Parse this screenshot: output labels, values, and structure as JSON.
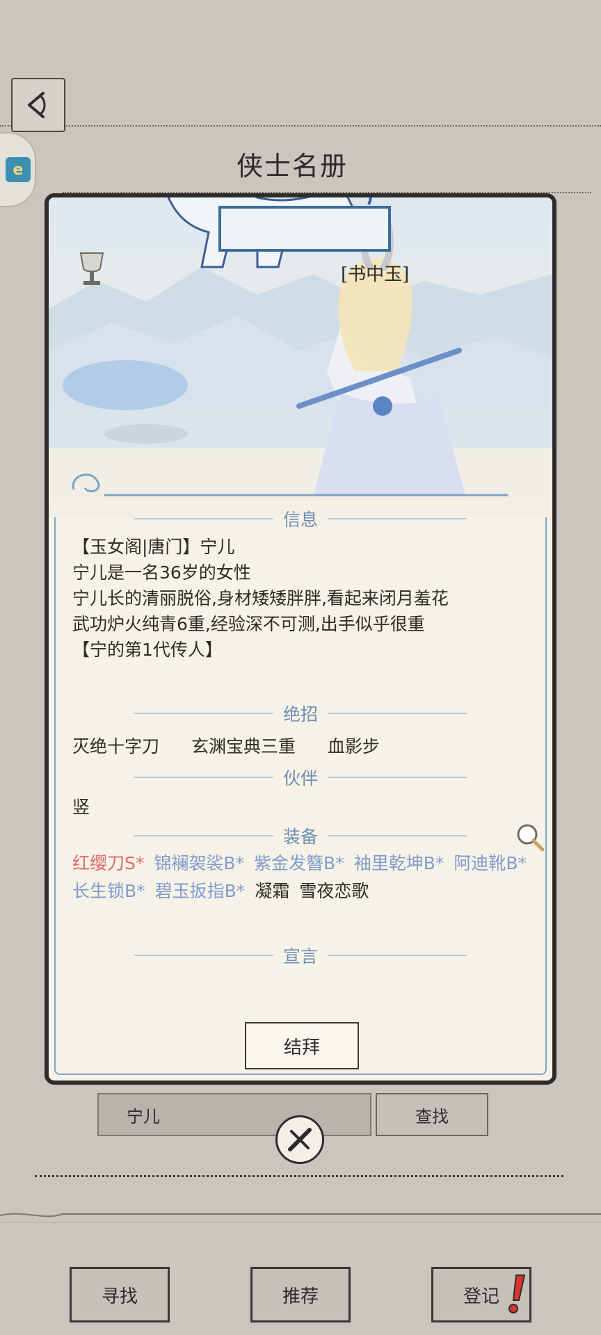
{
  "page_title": "侠士名册",
  "header_tag": "[书中玉]",
  "side_tab_chip": "e",
  "sections": {
    "info": "信息",
    "skills": "绝招",
    "partner": "伙伴",
    "equipment": "装备",
    "declaration": "宣言"
  },
  "info_lines": [
    "【玉女阁|唐门】宁儿",
    "宁儿是一名36岁的女性",
    "宁儿长的清丽脱俗,身材矮矮胖胖,看起来闭月羞花",
    "武功炉火纯青6重,经验深不可测,出手似乎很重",
    "【宁的第1代传人】"
  ],
  "skills": [
    "灭绝十字刀",
    "玄渊宝典三重",
    "血影步"
  ],
  "partner": "竖",
  "equipment": [
    {
      "name": "红缨刀S*",
      "grade": "S"
    },
    {
      "name": "锦襕袈裟B*",
      "grade": "B"
    },
    {
      "name": "紫金发簪B*",
      "grade": "B"
    },
    {
      "name": "袖里乾坤B*",
      "grade": "B"
    },
    {
      "name": "阿迪靴B*",
      "grade": "B"
    },
    {
      "name": "长生锁B*",
      "grade": "B"
    },
    {
      "name": "碧玉扳指B*",
      "grade": "B"
    },
    {
      "name": "凝霜",
      "grade": "N"
    },
    {
      "name": "雪夜恋歌",
      "grade": "N"
    }
  ],
  "buttons": {
    "jiebai": "结拜",
    "search": "查找",
    "find": "寻找",
    "recommend": "推荐",
    "register": "登记"
  },
  "search_input_value": "宁儿",
  "colors": {
    "accent_blue": "#6f8fb3",
    "grade_s": "#e06a68",
    "grade_b": "#7f9ccc",
    "alert": "#d9342b"
  },
  "icons": [
    "back-arrow-icon",
    "trophy-cup-icon",
    "magnifier-icon",
    "sword-close-icon",
    "exclamation-alert-icon",
    "qilin-mascot-icon"
  ]
}
